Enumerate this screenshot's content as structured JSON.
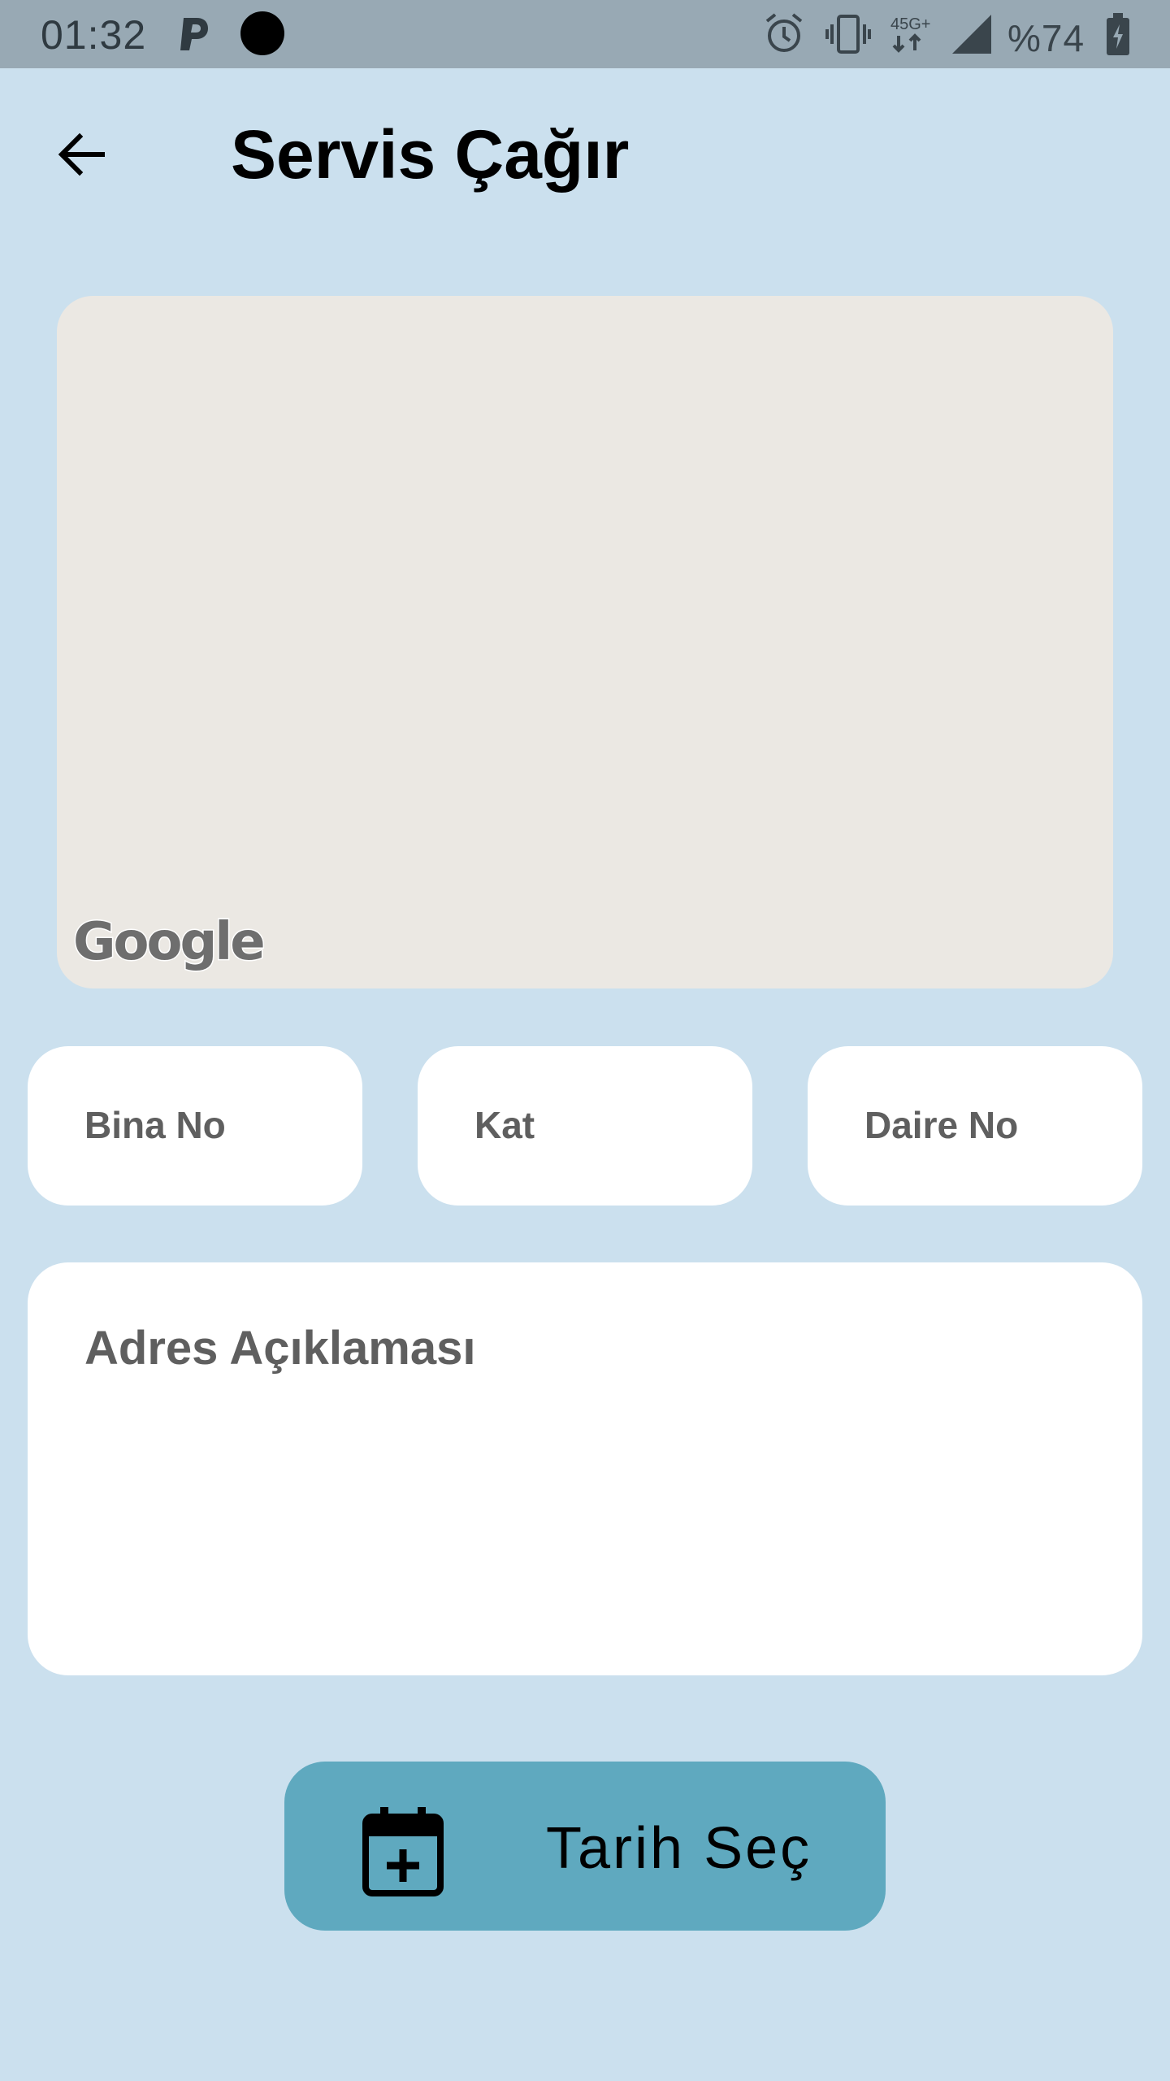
{
  "status_bar": {
    "time": "01:32",
    "network_label": "4.5G+",
    "battery": "%74",
    "icons": [
      "parking-icon",
      "notification-dot-icon",
      "alarm-icon",
      "vibrate-icon",
      "network-45g-icon",
      "signal-icon",
      "battery-charging-icon"
    ]
  },
  "header": {
    "title": "Servis Çağır",
    "back_icon": "arrow-left-icon"
  },
  "map": {
    "logo_text": "Google"
  },
  "fields": {
    "bina_no": {
      "placeholder": "Bina No",
      "value": ""
    },
    "kat": {
      "placeholder": "Kat",
      "value": ""
    },
    "daire_no": {
      "placeholder": "Daire No",
      "value": ""
    },
    "adres_aciklamasi": {
      "placeholder": "Adres Açıklaması",
      "value": ""
    }
  },
  "date_button": {
    "label": "Tarih Seç",
    "icon": "calendar-add-icon"
  },
  "colors": {
    "background": "#cbe0ee",
    "status_bar": "#98a9b4",
    "map": "#ebe8e3",
    "button": "#5fa9bf",
    "placeholder": "#5f5f5f"
  }
}
